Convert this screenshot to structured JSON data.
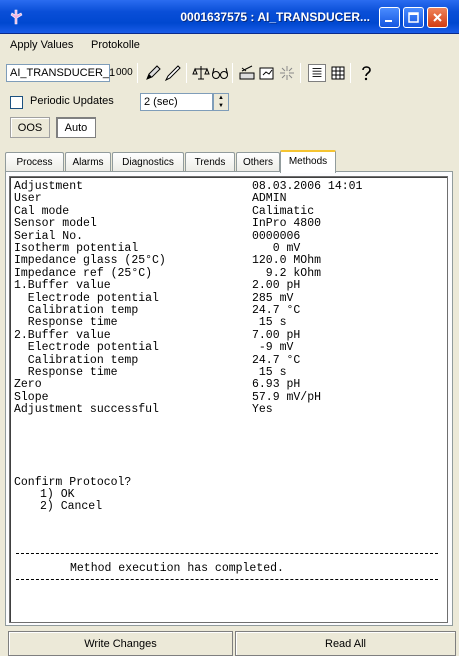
{
  "window": {
    "title": "0001637575 : AI_TRANSDUCER...",
    "minimize_icon": "minimize-icon",
    "maximize_icon": "maximize-icon",
    "close_icon": "close-icon"
  },
  "menu": {
    "items": [
      "Apply Values",
      "Protokolle"
    ]
  },
  "toolbar": {
    "device_name": "AI_TRANSDUCER_1",
    "device_index": "000",
    "icons": [
      "pencil-icon",
      "edit-pen-icon",
      "scale-icon",
      "glasses-icon",
      "write-device-icon",
      "read-device-icon",
      "sparkle-icon",
      "list-view-icon",
      "grid-view-icon",
      "help-icon"
    ]
  },
  "periodic": {
    "label": "Periodic Updates",
    "checked": false,
    "interval": "2 (sec)"
  },
  "modes": [
    "OOS",
    "Auto"
  ],
  "tabs": [
    "Process",
    "Alarms",
    "Diagnostics",
    "Trends",
    "Others",
    "Methods"
  ],
  "active_tab": "Methods",
  "protocol": {
    "rows": [
      {
        "label": "Adjustment",
        "value": "08.03.2006 14:01"
      },
      {
        "label": "User",
        "value": "ADMIN"
      },
      {
        "label": "Cal mode",
        "value": "Calimatic"
      },
      {
        "label": "Sensor model",
        "value": "InPro 4800"
      },
      {
        "label": "Serial No.",
        "value": "0000006"
      },
      {
        "label": "Isotherm potential",
        "value": "   0 mV"
      },
      {
        "label": "Impedance glass (25°C)",
        "value": "120.0 MOhm"
      },
      {
        "label": "Impedance ref (25°C)",
        "value": "  9.2 kOhm"
      },
      {
        "label": "1.Buffer value",
        "value": "2.00 pH"
      },
      {
        "label": "  Electrode potential",
        "value": "285 mV"
      },
      {
        "label": "  Calibration temp",
        "value": "24.7 °C"
      },
      {
        "label": "  Response time",
        "value": " 15 s"
      },
      {
        "label": "2.Buffer value",
        "value": "7.00 pH"
      },
      {
        "label": "  Electrode potential",
        "value": " -9 mV"
      },
      {
        "label": "  Calibration temp",
        "value": "24.7 °C"
      },
      {
        "label": "  Response time",
        "value": " 15 s"
      },
      {
        "label": "Zero",
        "value": "6.93 pH"
      },
      {
        "label": "Slope",
        "value": "57.9 mV/pH"
      },
      {
        "label": "Adjustment successful",
        "value": "Yes"
      }
    ],
    "confirm_title": "Confirm Protocol?",
    "options": [
      "1) OK",
      "2) Cancel"
    ],
    "status": "Method execution has completed."
  },
  "buttons": {
    "write": "Write Changes",
    "read": "Read All"
  }
}
